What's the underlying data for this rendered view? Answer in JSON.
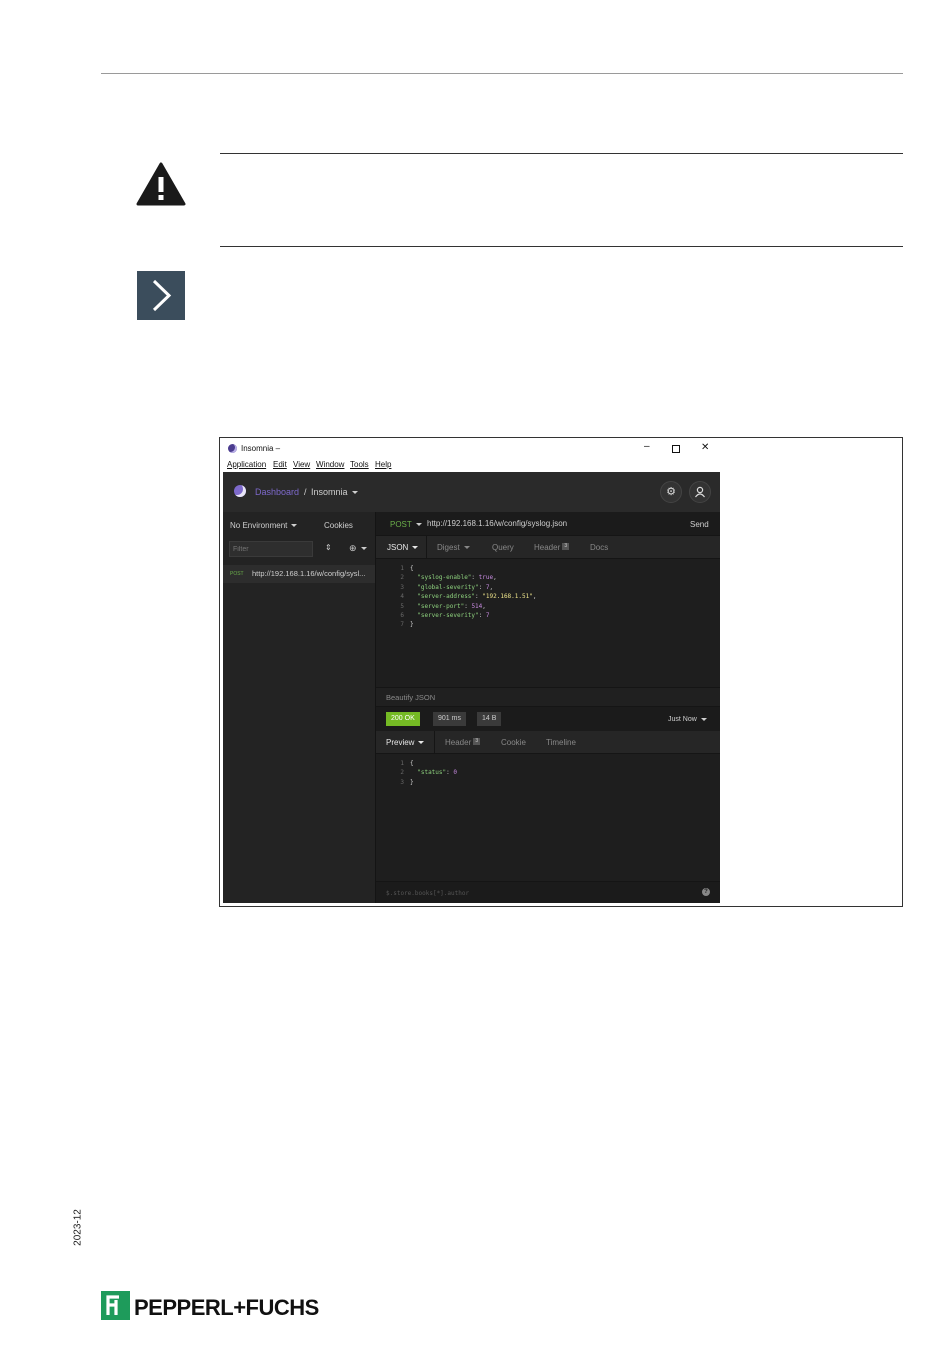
{
  "doc": {
    "date_code": "2023-12",
    "brand_name": "PEPPERL+FUCHS"
  },
  "app": {
    "window_title": "Insomnia –",
    "menu": [
      "Application",
      "Edit",
      "View",
      "Window",
      "Tools",
      "Help"
    ],
    "breadcrumb_root": "Dashboard",
    "breadcrumb_sep": "/",
    "workspace": "Insomnia",
    "environment": "No Environment",
    "cookies": "Cookies",
    "filter_placeholder": "Filter",
    "request_item": {
      "method": "POST",
      "url": "http://192.168.1.16/w/config/sysl..."
    },
    "request": {
      "method": "POST",
      "url": "http://192.168.1.16/w/config/syslog.json",
      "send": "Send"
    },
    "request_tabs": [
      "JSON",
      "Digest",
      "Query",
      "Header",
      "Docs"
    ],
    "header_count": "3",
    "body_lines": [
      {
        "n": "1",
        "text": "{"
      },
      {
        "n": "2",
        "key": "\"syslog-enable\"",
        "val": "true",
        "type": "bool",
        "comma": ","
      },
      {
        "n": "3",
        "key": "\"global-severity\"",
        "val": "7",
        "type": "num",
        "comma": ","
      },
      {
        "n": "4",
        "key": "\"server-address\"",
        "val": "\"192.168.1.51\"",
        "type": "str",
        "comma": ","
      },
      {
        "n": "5",
        "key": "\"server-port\"",
        "val": "514",
        "type": "num",
        "comma": ","
      },
      {
        "n": "6",
        "key": "\"server-severity\"",
        "val": "7",
        "type": "num",
        "comma": ""
      },
      {
        "n": "7",
        "text": "}"
      }
    ],
    "beautify": "Beautify JSON",
    "response": {
      "status": "200 OK",
      "time": "901 ms",
      "size": "14 B",
      "when": "Just Now"
    },
    "response_tabs": [
      "Preview",
      "Header",
      "Cookie",
      "Timeline"
    ],
    "response_header_count": "3",
    "response_lines": [
      {
        "n": "1",
        "text": "{"
      },
      {
        "n": "2",
        "key": "\"status\"",
        "val": "0",
        "type": "num",
        "comma": ""
      },
      {
        "n": "3",
        "text": "}"
      }
    ],
    "filter_bar_placeholder": "$.store.books[*].author",
    "help_glyph": "?",
    "colors": {
      "accent": "#7d69cb",
      "ok_green": "#75ba24",
      "post_green": "#6aad4a"
    }
  }
}
